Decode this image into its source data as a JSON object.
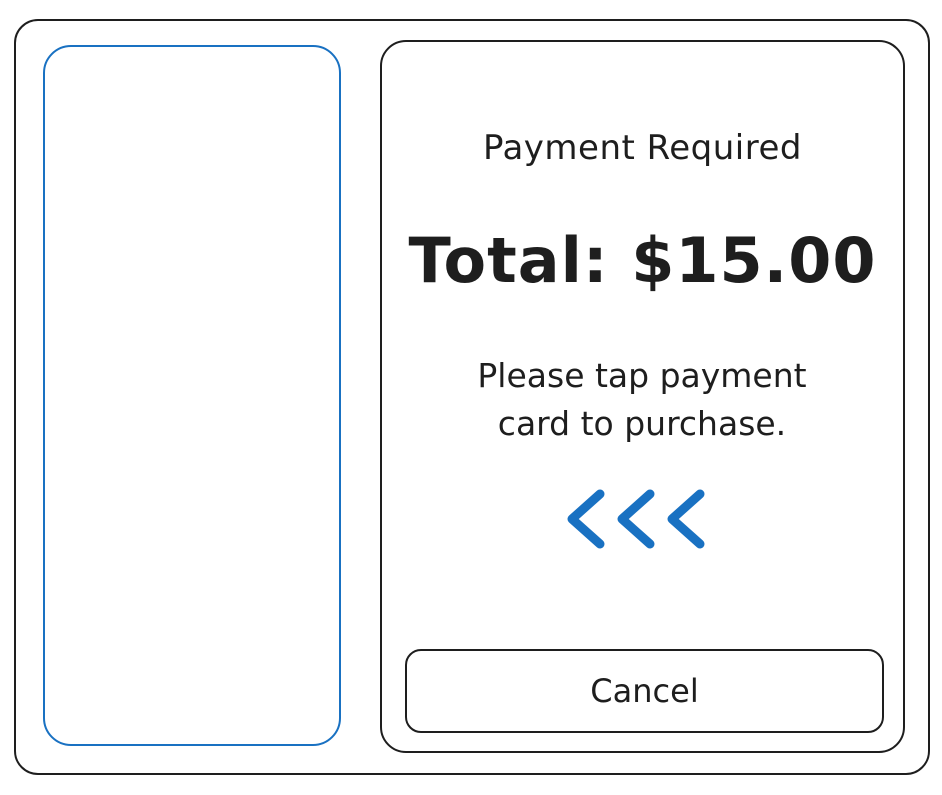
{
  "screen": {
    "title": "Payment Required",
    "total": "Total: $15.00",
    "instructions": "Please tap payment card to purchase.",
    "arrows_icon": "chevrons-left-icon",
    "cancel_label": "Cancel"
  },
  "colors": {
    "accent": "#1971c2",
    "stroke": "#1e1e1e",
    "background": "#ffffff"
  }
}
